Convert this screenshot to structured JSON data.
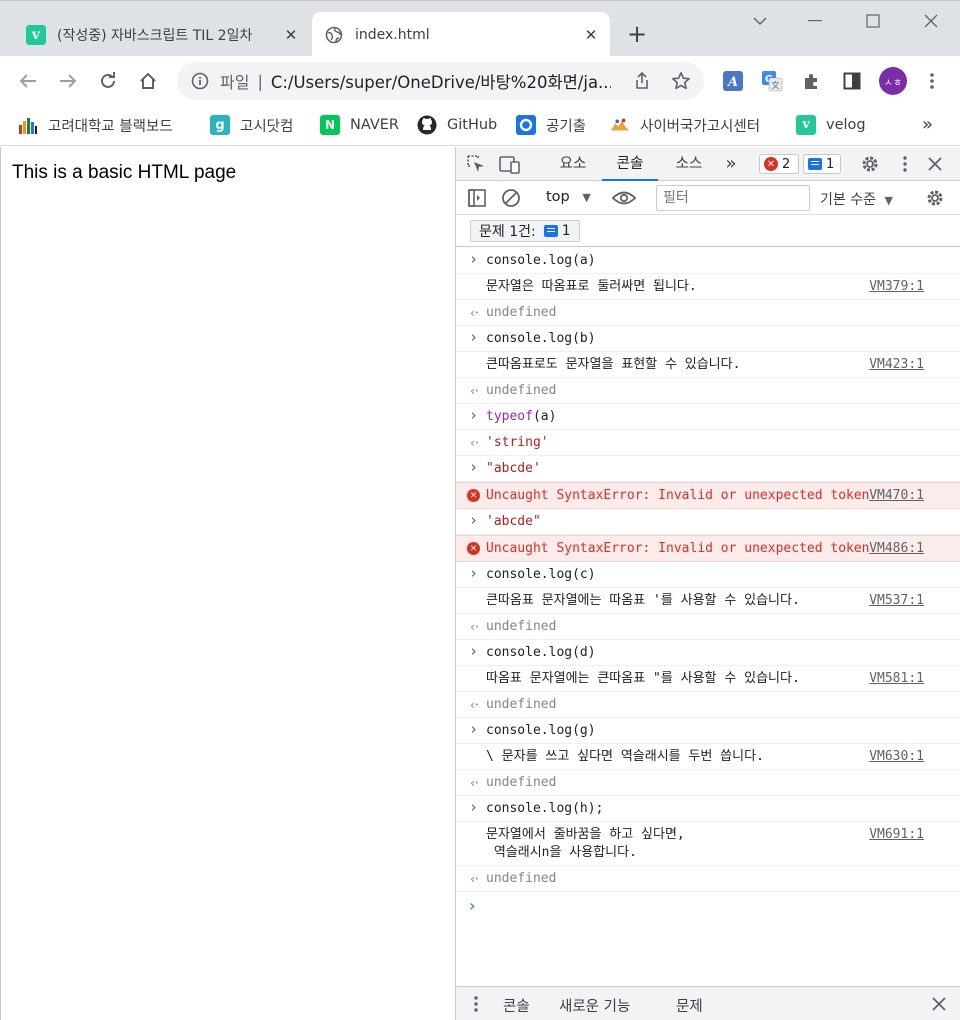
{
  "tabs": [
    {
      "title": "(작성중) 자바스크립트 TIL 2일차",
      "icon": "velog-icon",
      "active": false
    },
    {
      "title": "index.html",
      "icon": "globe-icon",
      "active": true
    }
  ],
  "omnibox": {
    "scheme": "파일",
    "separator": "|",
    "url": "C:/Users/super/OneDrive/바탕%20화면/ja..."
  },
  "account": {
    "initials": "ㅅㅎ"
  },
  "bookmarks": [
    {
      "label": "고려대학교 블랙보드",
      "icon": "blackboard-icon",
      "color": "#1a1a1a"
    },
    {
      "label": "고시닷컴",
      "icon": "gosi-icon",
      "color": "#2bb3c0"
    },
    {
      "label": "NAVER",
      "icon": "naver-icon",
      "color": "#03c75a"
    },
    {
      "label": "GitHub",
      "icon": "github-icon",
      "color": "#24292e"
    },
    {
      "label": "공기출",
      "icon": "gonggi-icon",
      "color": "#1a73e8"
    },
    {
      "label": "사이버국가고시센터",
      "icon": "cyber-icon",
      "color": "#e8a33d"
    },
    {
      "label": "velog",
      "icon": "velog-icon",
      "color": "#20c997"
    }
  ],
  "bookmarks_more": "»",
  "page": {
    "body_text": "This is a basic HTML page"
  },
  "devtools": {
    "tabs": [
      "요소",
      "콘솔",
      "소스"
    ],
    "active_tab": "콘솔",
    "more_tabs": "»",
    "error_count": "2",
    "issue_count": "1",
    "context": "top",
    "filter_placeholder": "필터",
    "log_level": "기본 수준",
    "issue_bar": {
      "label": "문제 1건:",
      "count": "1"
    },
    "drawer_tabs": [
      "콘솔",
      "새로운 기능",
      "문제"
    ]
  },
  "console": [
    {
      "type": "input",
      "text": "console.log(a)"
    },
    {
      "type": "log",
      "text": "문자열은 따옴표로 둘러싸면 됩니다.",
      "src": "VM379:1"
    },
    {
      "type": "result",
      "text": "undefined"
    },
    {
      "type": "input",
      "text": "console.log(b)"
    },
    {
      "type": "log",
      "text": "큰따옴표로도 문자열을 표현할 수 있습니다.",
      "src": "VM423:1"
    },
    {
      "type": "result",
      "text": "undefined"
    },
    {
      "type": "input",
      "text": "typeof(a)"
    },
    {
      "type": "result-str",
      "text": "'string'"
    },
    {
      "type": "input-str",
      "text": "\"abcde'"
    },
    {
      "type": "error",
      "text": "Uncaught SyntaxError: Invalid or unexpected token",
      "src": "VM470:1"
    },
    {
      "type": "input-str",
      "text": "'abcde\""
    },
    {
      "type": "error",
      "text": "Uncaught SyntaxError: Invalid or unexpected token",
      "src": "VM486:1"
    },
    {
      "type": "input",
      "text": "console.log(c)"
    },
    {
      "type": "log",
      "text": "큰따옴표 문자열에는 따옴표 '를 사용할 수 있습니다.",
      "src": "VM537:1"
    },
    {
      "type": "result",
      "text": "undefined"
    },
    {
      "type": "input",
      "text": "console.log(d)"
    },
    {
      "type": "log",
      "text": "따옴표 문자열에는 큰따옴표 \"를 사용할 수 있습니다.",
      "src": "VM581:1"
    },
    {
      "type": "result",
      "text": "undefined"
    },
    {
      "type": "input",
      "text": "console.log(g)"
    },
    {
      "type": "log",
      "text": "\\ 문자를 쓰고 싶다면 역슬래시를 두번 씁니다.",
      "src": "VM630:1"
    },
    {
      "type": "result",
      "text": "undefined"
    },
    {
      "type": "input",
      "text": "console.log(h);"
    },
    {
      "type": "log",
      "text": "문자열에서 줄바꿈을 하고 싶다면,\n 역슬래시n을 사용합니다.",
      "src": "VM691:1"
    },
    {
      "type": "result",
      "text": "undefined"
    }
  ]
}
